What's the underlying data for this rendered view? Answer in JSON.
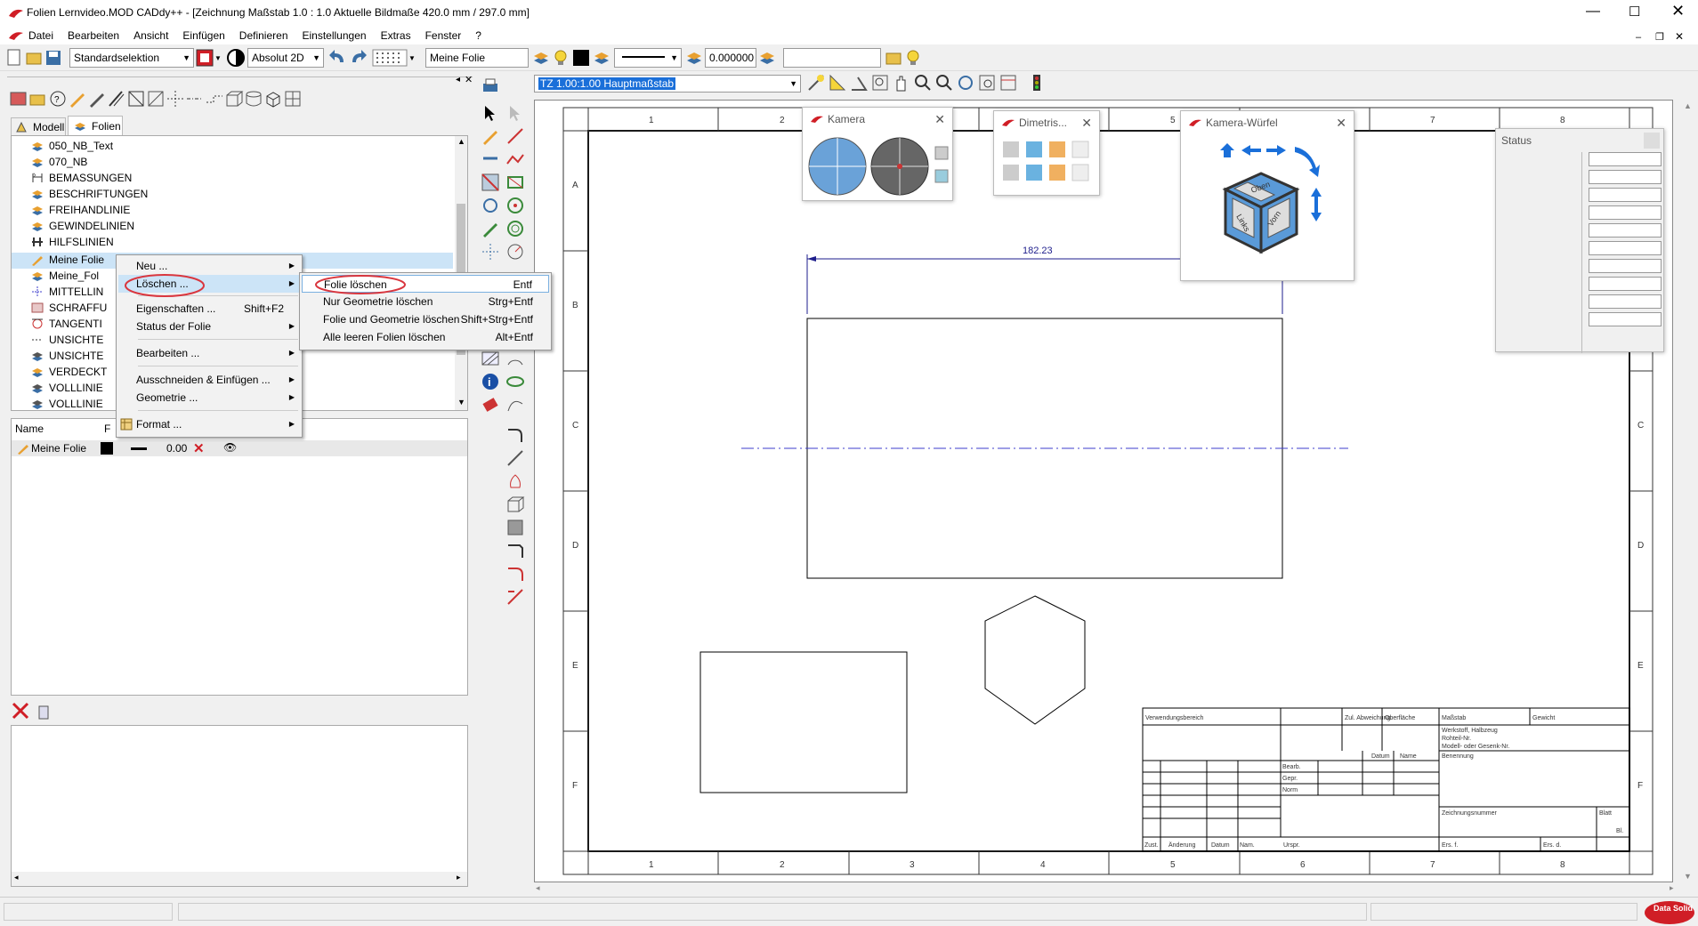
{
  "window": {
    "title": "Folien Lernvideo.MOD   CADdy++ - [Zeichnung   Maßstab 1.0 : 1.0   Aktuelle Bildmaße 420.0 mm / 297.0 mm]"
  },
  "menu": [
    "Datei",
    "Bearbeiten",
    "Ansicht",
    "Einfügen",
    "Definieren",
    "Einstellungen",
    "Extras",
    "Fenster",
    "?"
  ],
  "toolbar": {
    "selection": "Standardselektion",
    "coord_mode": "Absolut 2D",
    "layer_name": "Meine Folie",
    "thickness": "0.000000"
  },
  "drawing_toolbar": {
    "scale_combo": "TZ 1.00:1.00 Hauptmaßstab"
  },
  "tabs": [
    "Modell",
    "Folien"
  ],
  "tree": {
    "items": [
      "050_NB_Text",
      "070_NB",
      "BEMASSUNGEN",
      "BESCHRIFTUNGEN",
      "FREIHANDLINIE",
      "GEWINDELINIEN",
      "HILFSLINIEN",
      "Meine Folie",
      "Meine_Fol",
      "MITTELLIN",
      "SCHRAFFU",
      "TANGENTI",
      "UNSICHTE",
      "UNSICHTE",
      "VERDECKT",
      "VOLLLINIE",
      "VOLLLINIE"
    ]
  },
  "layer_table": {
    "headers": [
      "Name",
      "F"
    ],
    "row": {
      "name": "Meine Folie",
      "value": "0.00"
    }
  },
  "context_menu": {
    "items": [
      {
        "label": "Neu ...",
        "shortcut": ""
      },
      {
        "label": "Löschen ...",
        "shortcut": ""
      },
      {
        "label": "Eigenschaften ...",
        "shortcut": "Shift+F2"
      },
      {
        "label": "Status der Folie",
        "shortcut": ""
      },
      {
        "label": "Bearbeiten ...",
        "shortcut": ""
      },
      {
        "label": "Ausschneiden & Einfügen ...",
        "shortcut": ""
      },
      {
        "label": "Geometrie ...",
        "shortcut": ""
      },
      {
        "label": "Format ...",
        "shortcut": ""
      }
    ]
  },
  "submenu": {
    "items": [
      {
        "label": "Folie löschen",
        "shortcut": "Entf"
      },
      {
        "label": "Nur Geometrie löschen",
        "shortcut": "Strg+Entf"
      },
      {
        "label": "Folie und Geometrie löschen",
        "shortcut": "Shift+Strg+Entf"
      },
      {
        "label": "Alle leeren Folien löschen",
        "shortcut": "Alt+Entf"
      }
    ]
  },
  "floating": {
    "camera": "Kamera",
    "dimetric": "Dimetris...",
    "cube": "Kamera-Würfel",
    "status": "Status",
    "cube_faces": {
      "top": "Oben",
      "left": "Links",
      "front": "Vorn"
    }
  },
  "drawing": {
    "dimension": "182.23",
    "columns": [
      "1",
      "2",
      "3",
      "4",
      "5",
      "6",
      "7",
      "8"
    ],
    "rows": [
      "A",
      "B",
      "C",
      "D",
      "E",
      "F"
    ],
    "titleblock": {
      "verwendung": "Verwendungsbereich",
      "abweichung": "Zul. Abweichung",
      "oberflaeche": "Oberfläche",
      "massstab": "Maßstab",
      "gewicht": "Gewicht",
      "werkstoff": "Werkstoff, Halbzeug",
      "rohteil": "Rohteil-Nr.",
      "modell": "Modell- oder Gesenk-Nr.",
      "datum": "Datum",
      "name": "Name",
      "benennung": "Benennung",
      "bearb": "Bearb.",
      "gepr": "Gepr.",
      "norm": "Norm",
      "zeichnungsnummer": "Zeichnungsnummer",
      "blatt": "Blatt",
      "bl": "Bl.",
      "zust": "Zust.",
      "aenderung": "Änderung",
      "datum2": "Datum",
      "name2": "Nam.",
      "urspr": "Urspr.",
      "ers_f": "Ers. f.",
      "ers_d": "Ers. d."
    }
  },
  "status_logo": "Data Solid",
  "colors": {
    "accent": "#1a6fd9",
    "highlight_oval": "#d9363e",
    "dimension": "#1e1e8c",
    "centerline": "#3c3ccd"
  }
}
